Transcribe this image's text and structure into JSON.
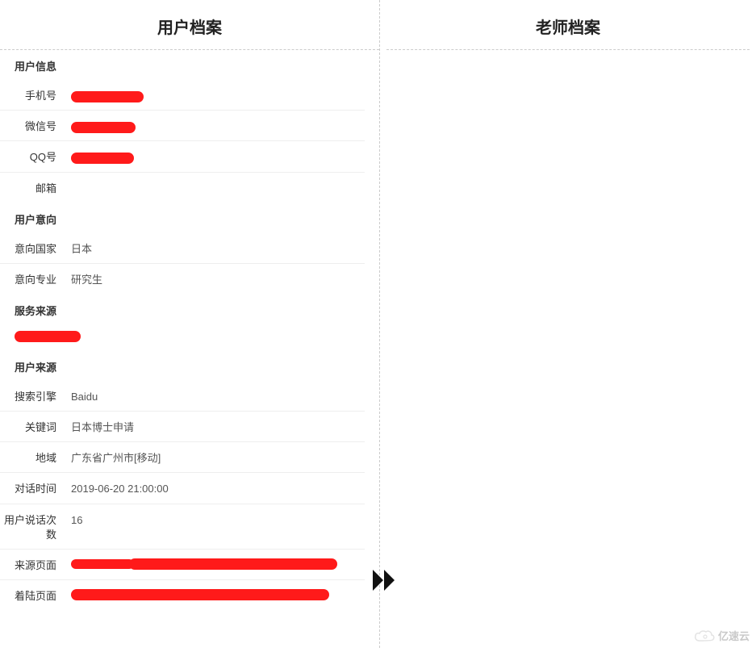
{
  "left": {
    "title": "用户档案",
    "sections": {
      "userInfo": {
        "header": "用户信息",
        "phone_label": "手机号",
        "wechat_label": "微信号",
        "qq_label": "QQ号",
        "email_label": "邮箱",
        "email_value": ""
      },
      "intention": {
        "header": "用户意向",
        "country_label": "意向国家",
        "country_value": "日本",
        "major_label": "意向专业",
        "major_value": "研究生"
      },
      "service": {
        "header": "服务来源"
      },
      "userSource": {
        "header": "用户来源",
        "engine_label": "搜索引擎",
        "engine_value": "Baidu",
        "keyword_label": "关键词",
        "keyword_value": "日本博士申请",
        "region_label": "地域",
        "region_value": "广东省广州市[移动]",
        "chattime_label": "对话时间",
        "chattime_value": "2019-06-20 21:00:00",
        "speakcount_label": "用户说话次数",
        "speakcount_value": "16",
        "srcpage_label": "来源页面",
        "landpage_label": "着陆页面"
      }
    }
  },
  "right": {
    "title": "老师档案"
  },
  "watermark": "亿速云"
}
